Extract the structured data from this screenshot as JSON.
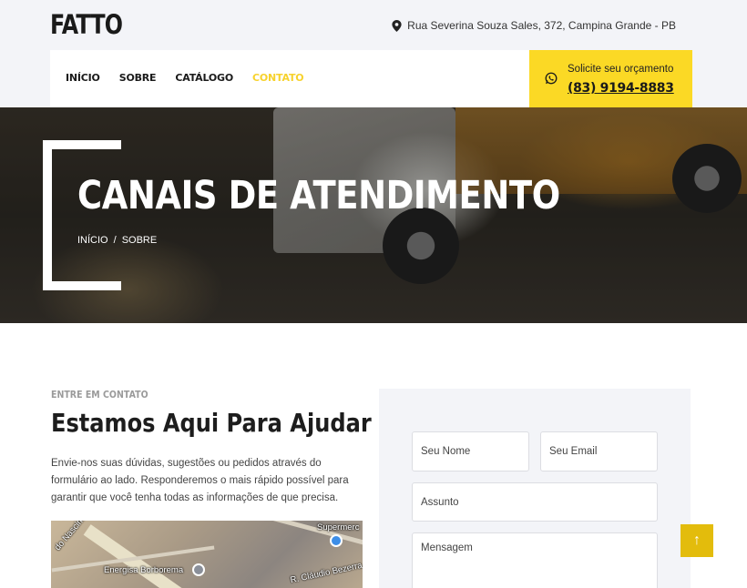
{
  "header": {
    "logo": "FATTO",
    "address": "Rua Severina Souza Sales, 372, Campina Grande - PB",
    "address_icon": "map-pin-icon"
  },
  "nav": {
    "items": [
      {
        "label": "INÍCIO"
      },
      {
        "label": "SOBRE"
      },
      {
        "label": "CATÁLOGO"
      },
      {
        "label": "CONTATO",
        "active": true
      }
    ],
    "active_color": "#f7d22d"
  },
  "quote": {
    "label": "Solicite seu orçamento",
    "phone": "(83) 9194-8883",
    "icon": "whatsapp-icon",
    "bg_color": "#fbd925"
  },
  "hero": {
    "title": "CANAIS DE ATENDIMENTO",
    "breadcrumb": [
      "INÍCIO",
      "/",
      "SOBRE"
    ]
  },
  "contact": {
    "eyebrow": "ENTRE EM CONTATO",
    "title": "Estamos Aqui Para Ajudar",
    "text": "Envie-nos suas dúvidas, sugestões ou pedidos através do formulário ao lado. Responderemos o mais rápido possível para garantir que você tenha todas as informações de que precisa."
  },
  "map": {
    "labels": [
      "do Nascimento",
      "Energisa Borborema",
      "Supermerc",
      "R. Cláudio Bezerra"
    ]
  },
  "form": {
    "name_placeholder": "Seu Nome",
    "email_placeholder": "Seu Email",
    "subject_placeholder": "Assunto",
    "message_placeholder": "Mensagem"
  },
  "scroll_top": {
    "icon": "arrow-up-icon",
    "glyph": "↑",
    "color": "#e3bc0c"
  }
}
